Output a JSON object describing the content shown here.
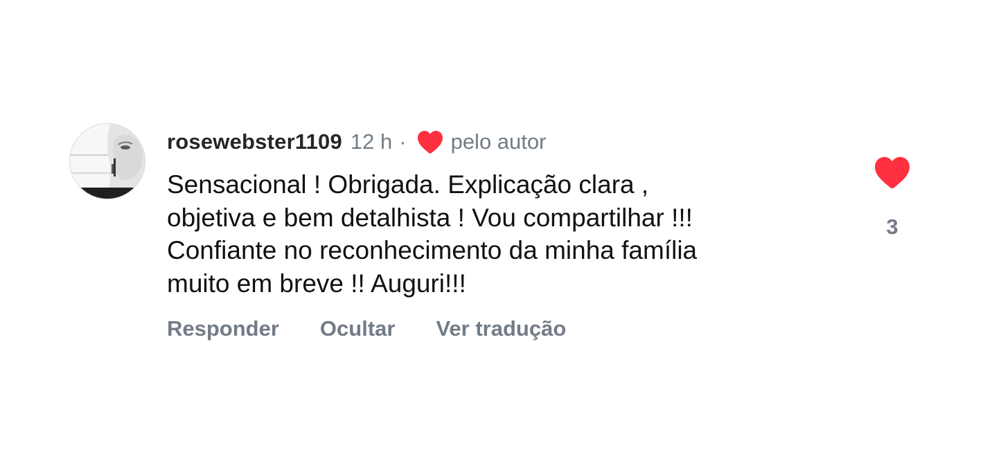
{
  "comment": {
    "username": "rosewebster1109",
    "time": "12 h",
    "separator": "·",
    "author_badge": {
      "icon": "heart-icon",
      "color": "#ff3040",
      "label": "pelo autor"
    },
    "text_lines": [
      "Sensacional ! Obrigada. Explicação clara ,",
      "objetiva e bem detalhista ! Vou compartilhar !!!",
      "Confiante no reconhecimento da minha família",
      "muito em breve !! Auguri!!!"
    ],
    "actions": {
      "reply": "Responder",
      "hide": "Ocultar",
      "translate": "Ver tradução"
    },
    "like": {
      "icon": "heart-icon",
      "color": "#ff3040",
      "count": "3",
      "liked": true
    }
  }
}
